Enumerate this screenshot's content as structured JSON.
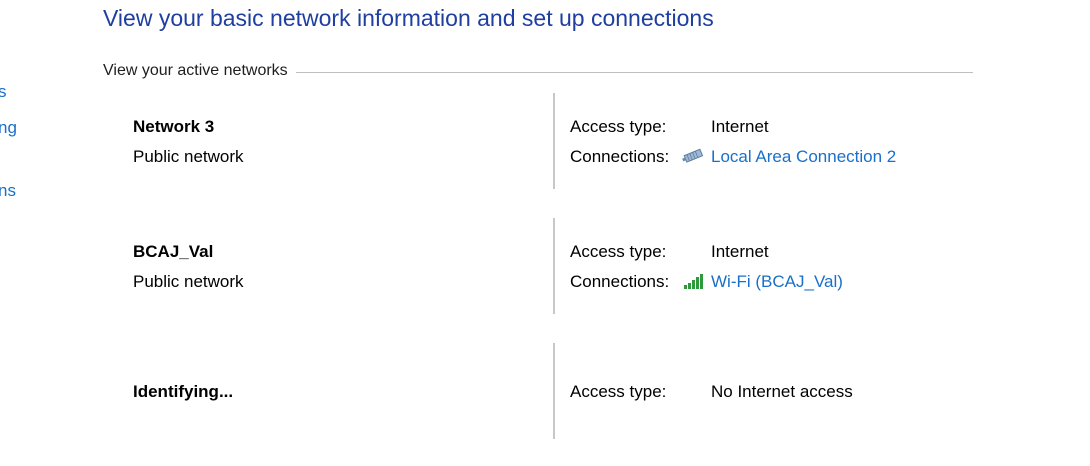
{
  "sidebar": {
    "fragments": [
      "s",
      "ng",
      "ns"
    ]
  },
  "page_title": "View your basic network information and set up connections",
  "active_networks": {
    "header": "View your active networks",
    "networks": [
      {
        "name": "Network 3",
        "category": "Public network",
        "access_label": "Access type:",
        "access_value": "Internet",
        "connections_label": "Connections:",
        "connection_icon": "ethernet-icon",
        "connection_name": "Local Area Connection 2"
      },
      {
        "name": "BCAJ_Val",
        "category": "Public network",
        "access_label": "Access type:",
        "access_value": "Internet",
        "connections_label": "Connections:",
        "connection_icon": "wifi-signal-icon",
        "connection_name": "Wi-Fi (BCAJ_Val)"
      },
      {
        "name": "Identifying...",
        "access_label": "Access type:",
        "access_value": "No Internet access"
      }
    ]
  },
  "colors": {
    "title": "#1e3ea0",
    "link": "#1a6fc9",
    "separator": "#c8c8c8"
  }
}
